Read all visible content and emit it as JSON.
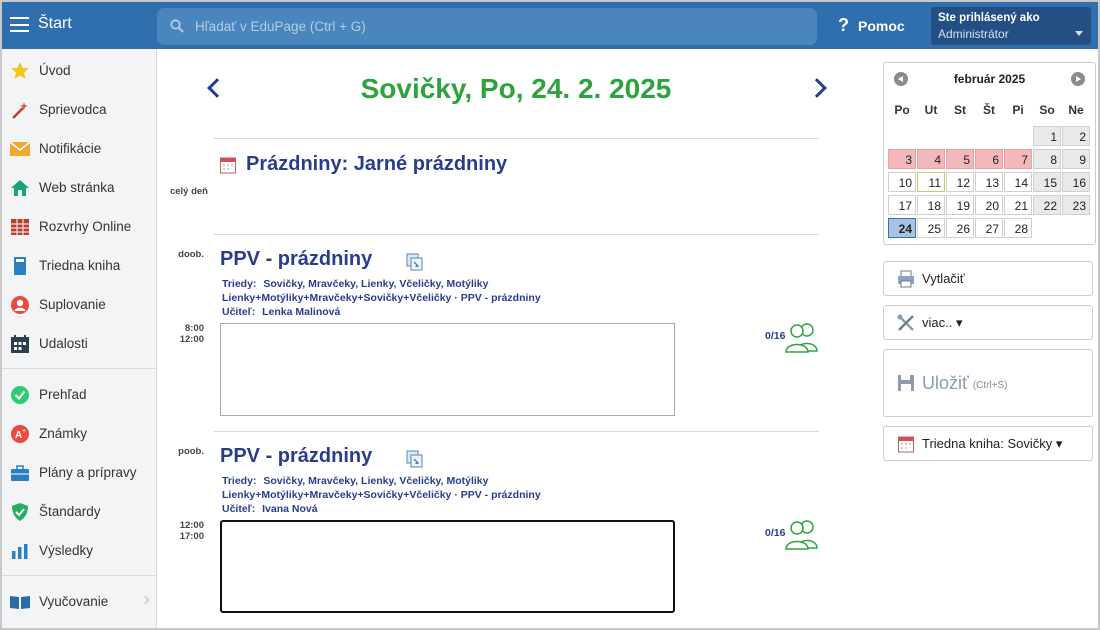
{
  "topbar": {
    "start_label": "Štart",
    "search_placeholder": "Hľadať v EduPage (Ctrl + G)",
    "help_label": "Pomoc",
    "user_line1": "Ste prihlásený ako",
    "user_line2": "Administrátor"
  },
  "sidebar": {
    "items": [
      {
        "label": "Úvod",
        "icon": "star-icon"
      },
      {
        "label": "Sprievodca",
        "icon": "magic-wand-icon"
      },
      {
        "label": "Notifikácie",
        "icon": "envelope-icon"
      },
      {
        "label": "Web stránka",
        "icon": "house-icon"
      },
      {
        "label": "Rozvrhy Online",
        "icon": "timetable-icon"
      },
      {
        "label": "Triedna kniha",
        "icon": "book-icon"
      },
      {
        "label": "Suplovanie",
        "icon": "substitute-person-icon"
      },
      {
        "label": "Udalosti",
        "icon": "calendar-icon"
      },
      {
        "label": "Prehľad",
        "icon": "check-circle-icon"
      },
      {
        "label": "Známky",
        "icon": "grade-icon"
      },
      {
        "label": "Plány a prípravy",
        "icon": "briefcase-icon"
      },
      {
        "label": "Štandardy",
        "icon": "shield-check-icon"
      },
      {
        "label": "Výsledky",
        "icon": "bar-chart-icon"
      },
      {
        "label": "Vyučovanie",
        "icon": "open-book-icon"
      }
    ]
  },
  "main": {
    "day_title": "Sovičky, Po, 24. 2. 2025",
    "holiday": {
      "time": "celý deň",
      "title": "Prázdniny: Jarné prázdniny"
    },
    "lessons": [
      {
        "period": "doob.",
        "title": "PPV - prázdniny",
        "classes_label": "Triedy:",
        "classes": "Sovičky, Mravčeky, Lienky, Včeličky, Motýliky",
        "group": "Lienky+Motýliky+Mravčeky+Sovičky+Včeličky · PPV - prázdniny",
        "teacher_label": "Učiteľ:",
        "teacher": "Lenka Malinová",
        "time_from": "8:00",
        "time_to": "12:00",
        "attendance": "0/16"
      },
      {
        "period": "poob.",
        "title": "PPV - prázdniny",
        "classes_label": "Triedy:",
        "classes": "Sovičky, Mravčeky, Lienky, Včeličky, Motýliky",
        "group": "Lienky+Motýliky+Mravčeky+Sovičky+Včeličky · PPV - prázdniny",
        "teacher_label": "Učiteľ:",
        "teacher": "Ivana Nová",
        "time_from": "12:00",
        "time_to": "17:00",
        "attendance": "0/16"
      }
    ]
  },
  "calendar": {
    "month": "február 2025",
    "weekdays": [
      "Po",
      "Ut",
      "St",
      "Št",
      "Pi",
      "So",
      "Ne"
    ],
    "days": [
      "1",
      "2",
      "3",
      "4",
      "5",
      "6",
      "7",
      "8",
      "9",
      "10",
      "11",
      "12",
      "13",
      "14",
      "15",
      "16",
      "17",
      "18",
      "19",
      "20",
      "21",
      "22",
      "23",
      "24",
      "25",
      "26",
      "27",
      "28"
    ],
    "holiday_days": [
      "3",
      "4",
      "5",
      "6",
      "7"
    ],
    "selected_day": "24",
    "today_day": "11",
    "colors": {
      "holiday": "#f4b8bb",
      "selected": "#a6c3e3",
      "weekend": "#e9e9e9"
    }
  },
  "actions": {
    "print_label": "Vytlačiť",
    "more_label": "viac.. ▾",
    "save_label": "Uložiť",
    "save_shortcut": "(Ctrl+S)",
    "classbook_label": "Triedna kniha: Sovičky ▾"
  },
  "colors": {
    "topbar": "#2f6fae",
    "title_green": "#2ea33d",
    "navy": "#2a3c8e"
  }
}
